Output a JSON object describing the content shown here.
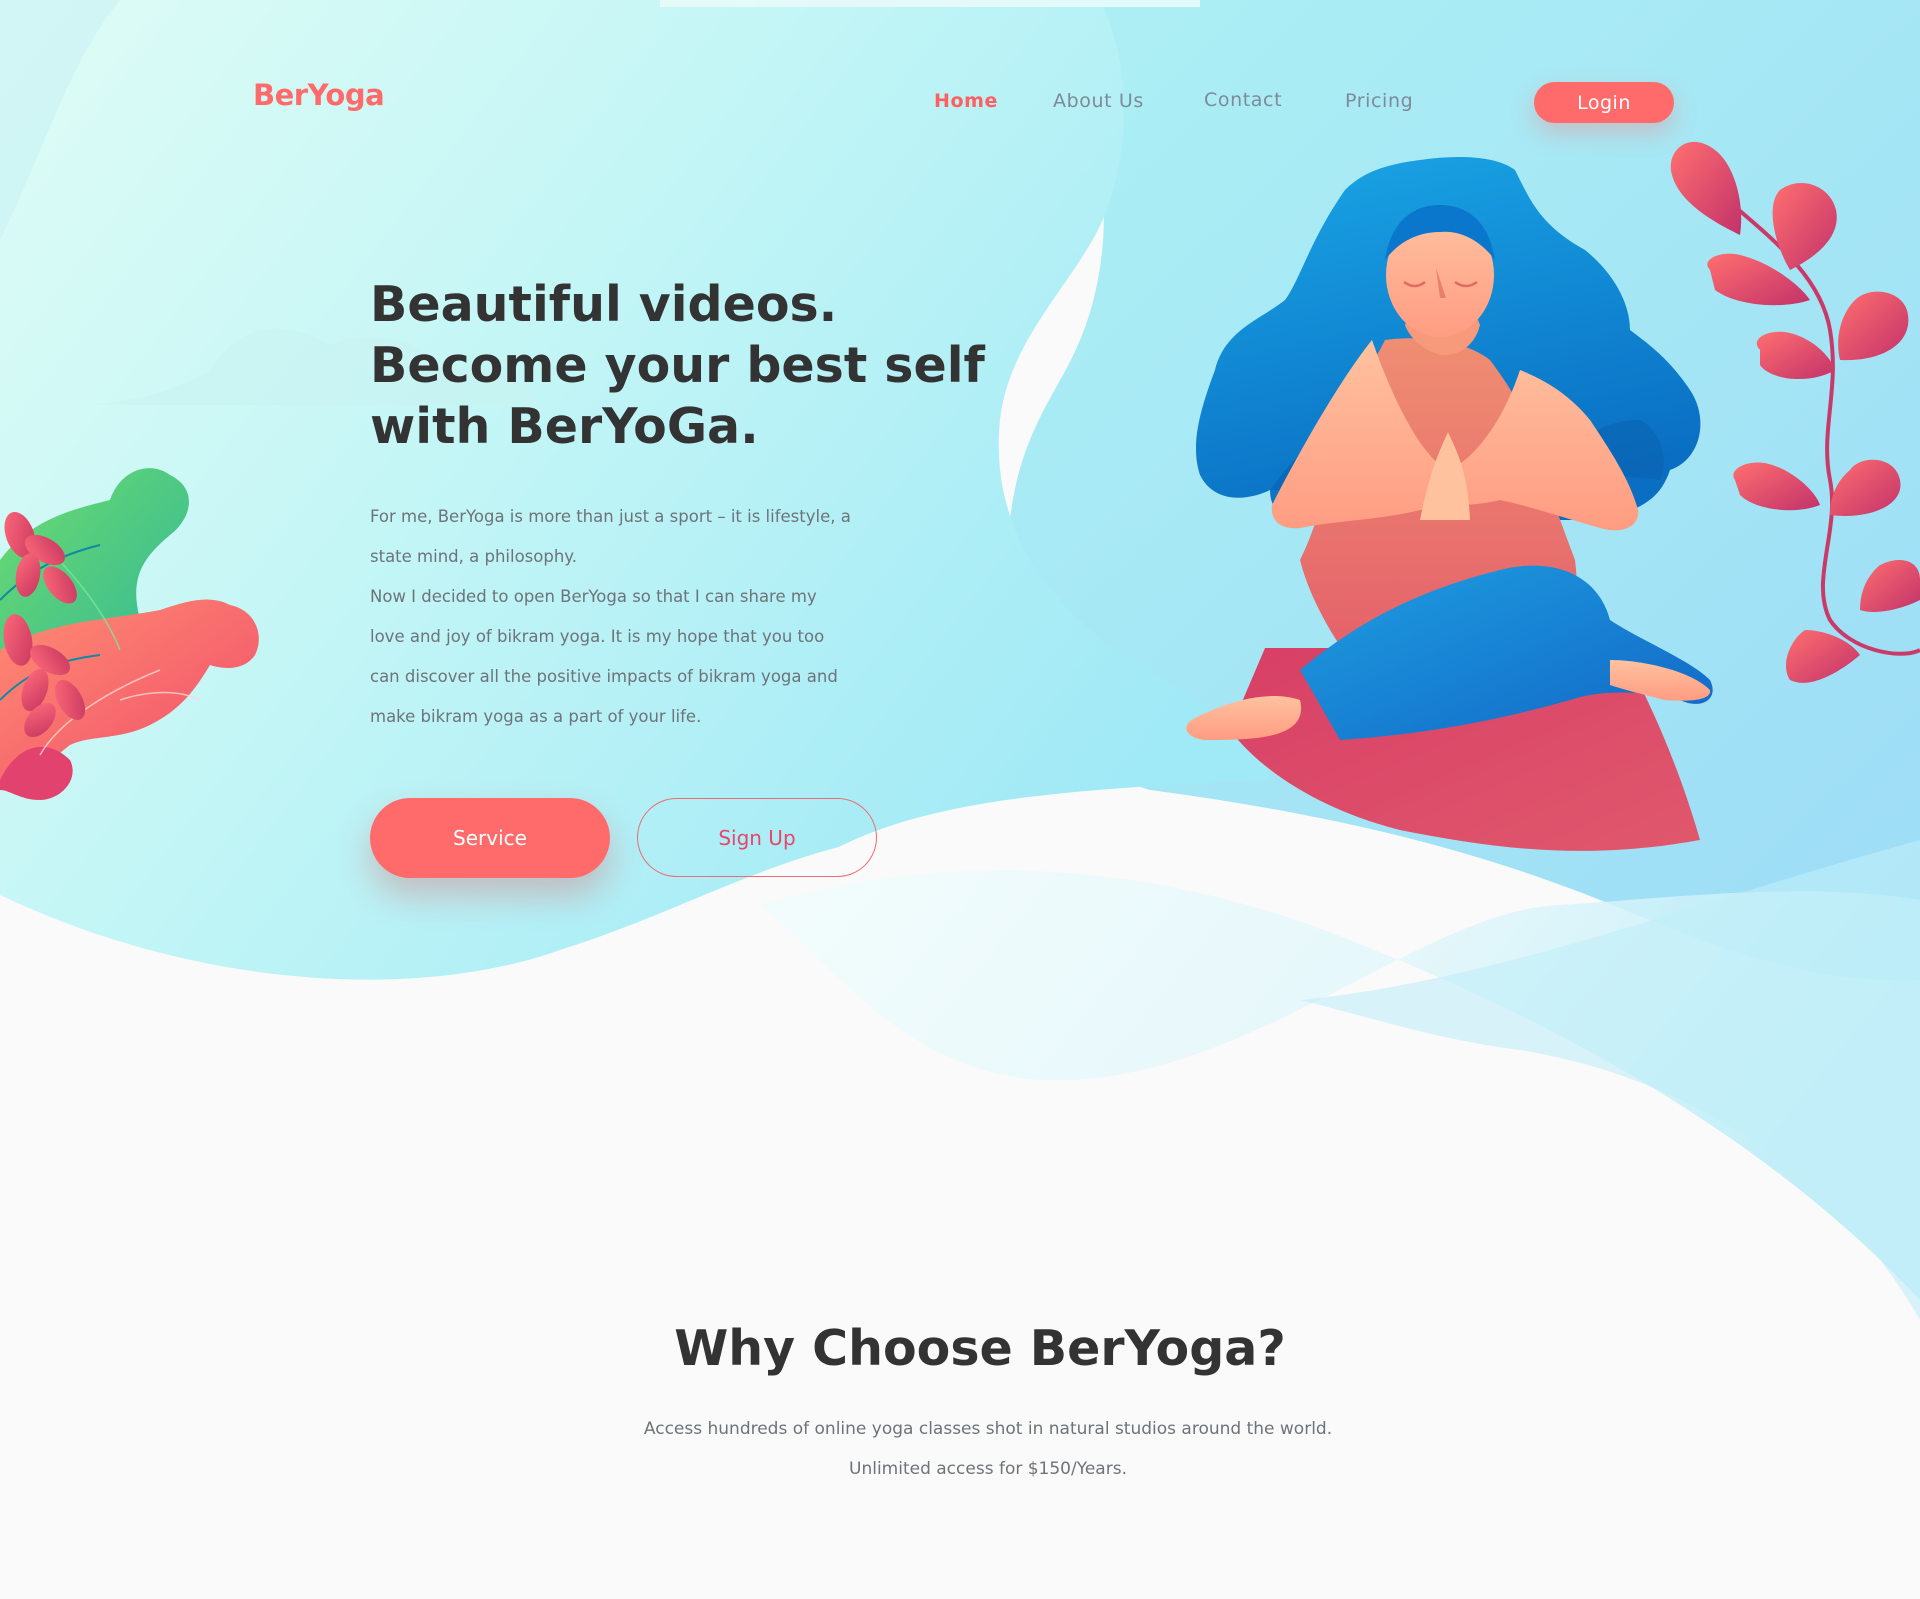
{
  "brand": {
    "name": "BerYoga",
    "color": "#ff6b6b"
  },
  "nav": {
    "items": [
      {
        "label": "Home",
        "active": true
      },
      {
        "label": "About Us",
        "active": false
      },
      {
        "label": "Contact",
        "active": false
      },
      {
        "label": "Pricing",
        "active": false
      }
    ],
    "login_label": "Login"
  },
  "hero": {
    "title_lines": [
      "Beautiful videos.",
      "Become your best self",
      "with BerYoGa."
    ],
    "body_lines": [
      "For me, BerYoga is more than just a sport – it is lifestyle, a",
      "state mind, a philosophy.",
      "Now I decided to open BerYoga so that I can share my",
      "love and joy of bikram yoga.  It is my hope that you too",
      "can discover all the positive impacts of bikram yoga and",
      "make bikram yoga as a part of your life."
    ],
    "primary_button": "Service",
    "secondary_button": "Sign Up"
  },
  "why": {
    "title": "Why Choose BerYoga?",
    "lines": [
      "Access hundreds of online yoga classes shot in natural studios around the world.",
      "Unlimited access for $150/Years."
    ]
  },
  "illustrations": {
    "hero_figure": "woman-meditating-illustration",
    "left_plant": "leaf-cluster-illustration",
    "right_plant": "vine-branch-illustration"
  },
  "colors": {
    "accent": "#ff6b6b",
    "accent_pink": "#e8466a",
    "hero_bg_top": "#dffcf6",
    "hero_bg_mid": "#b6f2f6",
    "hero_bg_right": "#9fe0f4",
    "heading": "#333333",
    "body_text": "#6e7379",
    "nav_text": "#7d8a99",
    "page_bg": "#fafafa"
  }
}
